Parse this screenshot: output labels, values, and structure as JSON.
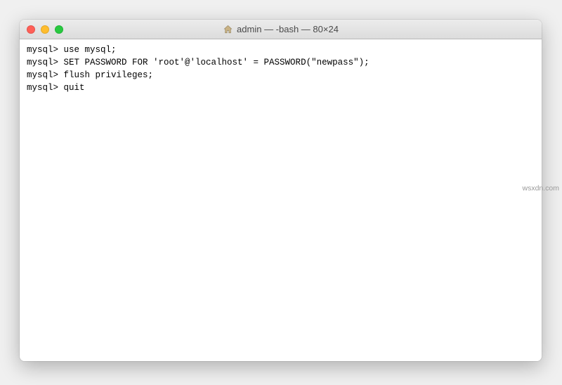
{
  "window": {
    "title": "admin — -bash — 80×24",
    "home_icon": "home-icon"
  },
  "terminal": {
    "lines": [
      {
        "prompt": "mysql>",
        "cmd": "use mysql;"
      },
      {
        "prompt": "mysql>",
        "cmd": "SET PASSWORD FOR 'root'@'localhost' = PASSWORD(\"newpass\");"
      },
      {
        "prompt": "mysql>",
        "cmd": "flush privileges;"
      },
      {
        "prompt": "mysql>",
        "cmd": "quit"
      }
    ]
  },
  "watermark": "wsxdn.com"
}
